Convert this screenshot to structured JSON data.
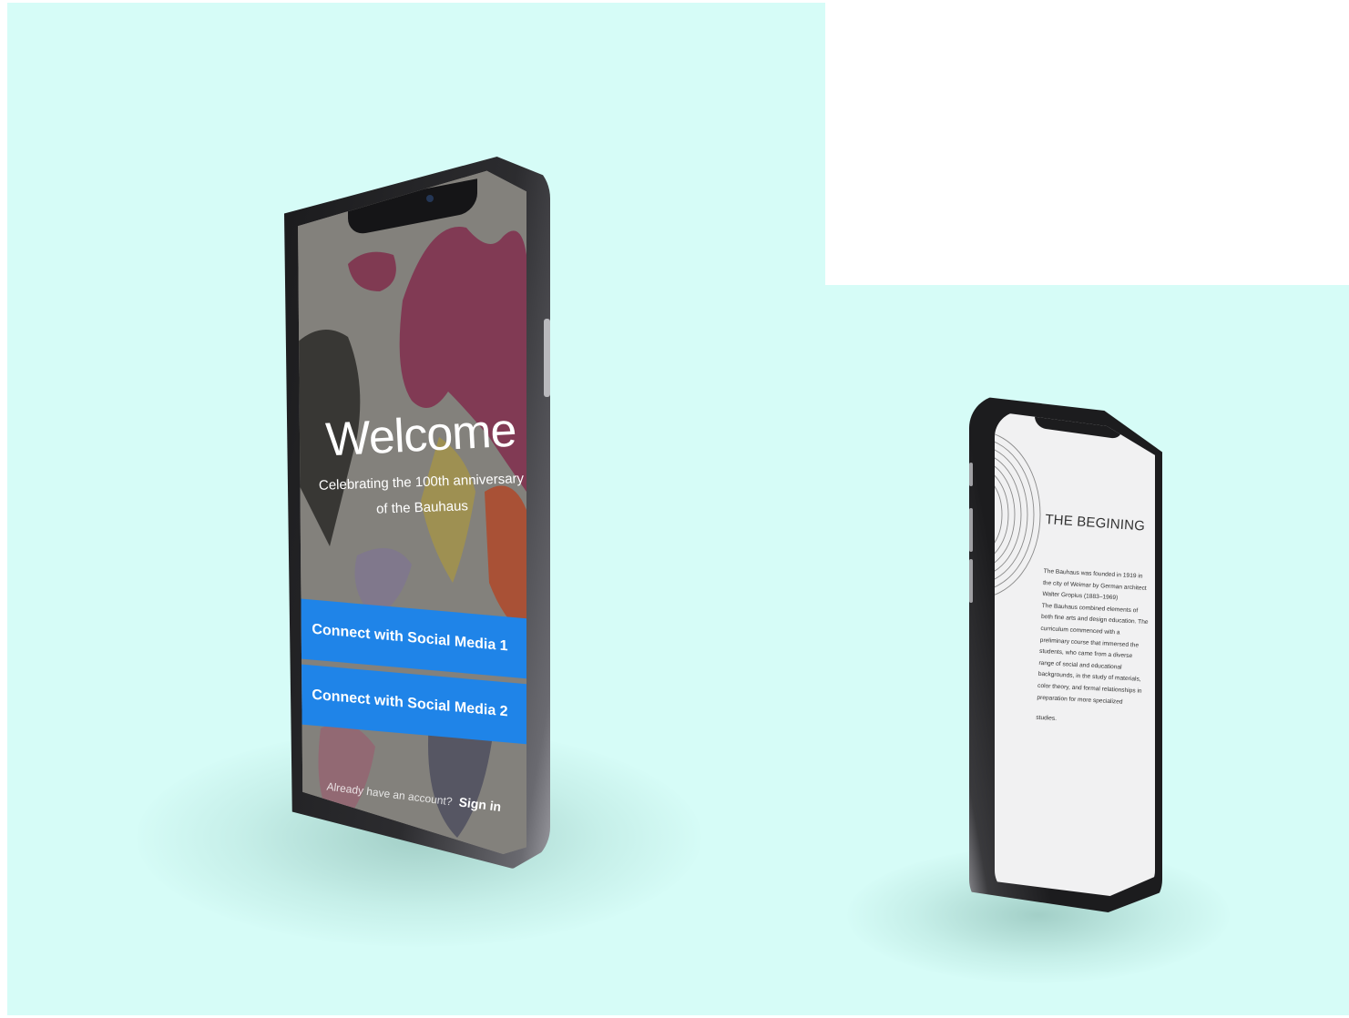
{
  "colors": {
    "background": "#d6fcf7",
    "button_blue": "#1f84e8",
    "welcome_text": "#ffffff",
    "article_background": "#f1f1f2",
    "article_text": "#333333"
  },
  "welcome_screen": {
    "title": "Welcome",
    "subtitle_line1": "Celebrating the 100th anniversary",
    "subtitle_line2": "of the Bauhaus",
    "button_1": "Connect with Social Media 1",
    "button_2": "Connect with Social Media 2",
    "account_prompt": "Already have an account?",
    "sign_in": "Sign in"
  },
  "article_screen": {
    "title": "THE BEGINING",
    "paragraph_1": "The Bauhaus was founded in 1919 in the city of Weimar by German architect Walter Gropius (1883–1969)",
    "paragraph_2": "The Bauhaus combined elements of both fine arts and design education. The curriculum commenced with a preliminary course that immersed the students, who came from a diverse range of social and educational backgrounds, in the study of materials, color theory, and formal relationships in preparation for more specialized",
    "paragraph_3": "studies."
  }
}
